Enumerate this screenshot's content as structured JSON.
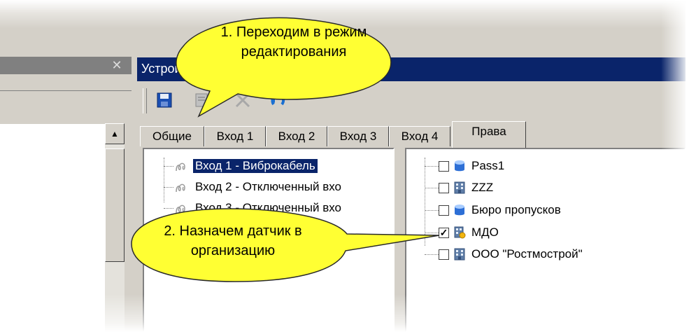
{
  "left_panel": {
    "close_glyph": "✕",
    "scroll_up_glyph": "▲"
  },
  "device_panel": {
    "title": "Устройст",
    "toolbar": {
      "save_icon": "floppy-disk-icon",
      "edit_icon": "edit-icon",
      "delete_icon": "delete-x-icon",
      "undo_icon": "undo-arrow-icon"
    },
    "tabs": [
      {
        "label": "Общие"
      },
      {
        "label": "Вход 1"
      },
      {
        "label": "Вход 2"
      },
      {
        "label": "Вход 3"
      },
      {
        "label": "Вход 4"
      },
      {
        "label": "Права",
        "active": true
      }
    ],
    "inputs": [
      {
        "label": "Вход 1 - Виброкабель",
        "selected": true
      },
      {
        "label": "Вход 2 - Отключенный вхо"
      },
      {
        "label": "Вход 3 - Отключенный вхо"
      }
    ],
    "rights": [
      {
        "label": "Pass1",
        "checked": false,
        "icon": "database-blue-icon"
      },
      {
        "label": "ZZZ",
        "checked": false,
        "icon": "building-icon"
      },
      {
        "label": "Бюро пропусков",
        "checked": false,
        "icon": "database-blue-icon"
      },
      {
        "label": "МДО",
        "checked": true,
        "icon": "building-star-icon"
      },
      {
        "label": "ООО \"Ростмострой\"",
        "checked": false,
        "icon": "building-icon"
      }
    ]
  },
  "callouts": {
    "step1": "1. Переходим в режим редактирования",
    "step2": "2. Назначем датчик в организацию"
  },
  "colors": {
    "title_active": "#0a246a",
    "title_inactive": "#808080",
    "window_face": "#d4d0c8",
    "callout_fill": "#ffff33"
  }
}
